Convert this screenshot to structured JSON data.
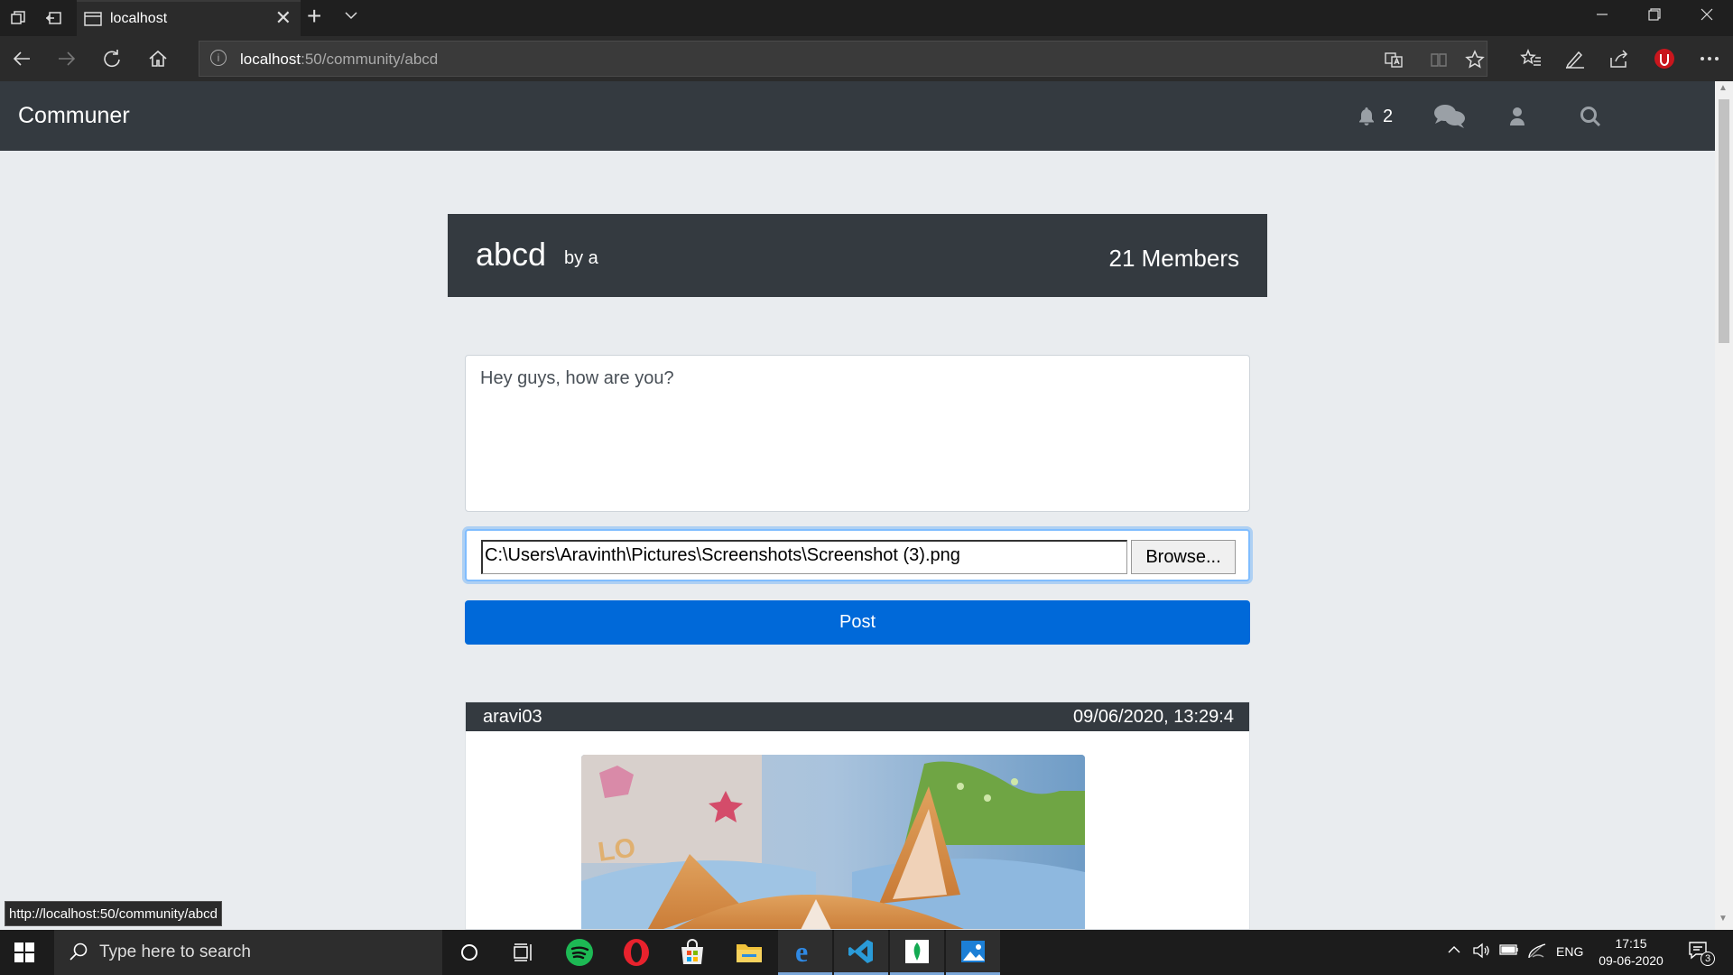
{
  "browser": {
    "tab_title": "localhost",
    "tab_close": "✕",
    "new_tab": "+",
    "address_host": "localhost",
    "address_path": ":50/community/abcd",
    "status_url": "http://localhost:50/community/abcd"
  },
  "app": {
    "brand": "Communer",
    "notification_count": "2"
  },
  "community": {
    "name": "abcd",
    "by": "by a",
    "members": "21 Members"
  },
  "composer": {
    "text": "Hey guys, how are you?",
    "file_path": "C:\\Users\\Aravinth\\Pictures\\Screenshots\\Screenshot (3).png",
    "browse_label": "Browse...",
    "post_label": "Post"
  },
  "posts": [
    {
      "author": "aravi03",
      "timestamp": "09/06/2020, 13:29:4"
    }
  ],
  "taskbar": {
    "search_placeholder": "Type here to search",
    "language": "ENG",
    "time": "17:15",
    "date": "09-06-2020",
    "notification_count": "3"
  },
  "icons": {
    "bell": "bell-icon",
    "chat": "chat-icon",
    "user": "user-icon",
    "search": "search-icon"
  },
  "colors": {
    "navbar": "#343a40",
    "primary": "#0069d9",
    "page_bg": "#e9ecef"
  }
}
